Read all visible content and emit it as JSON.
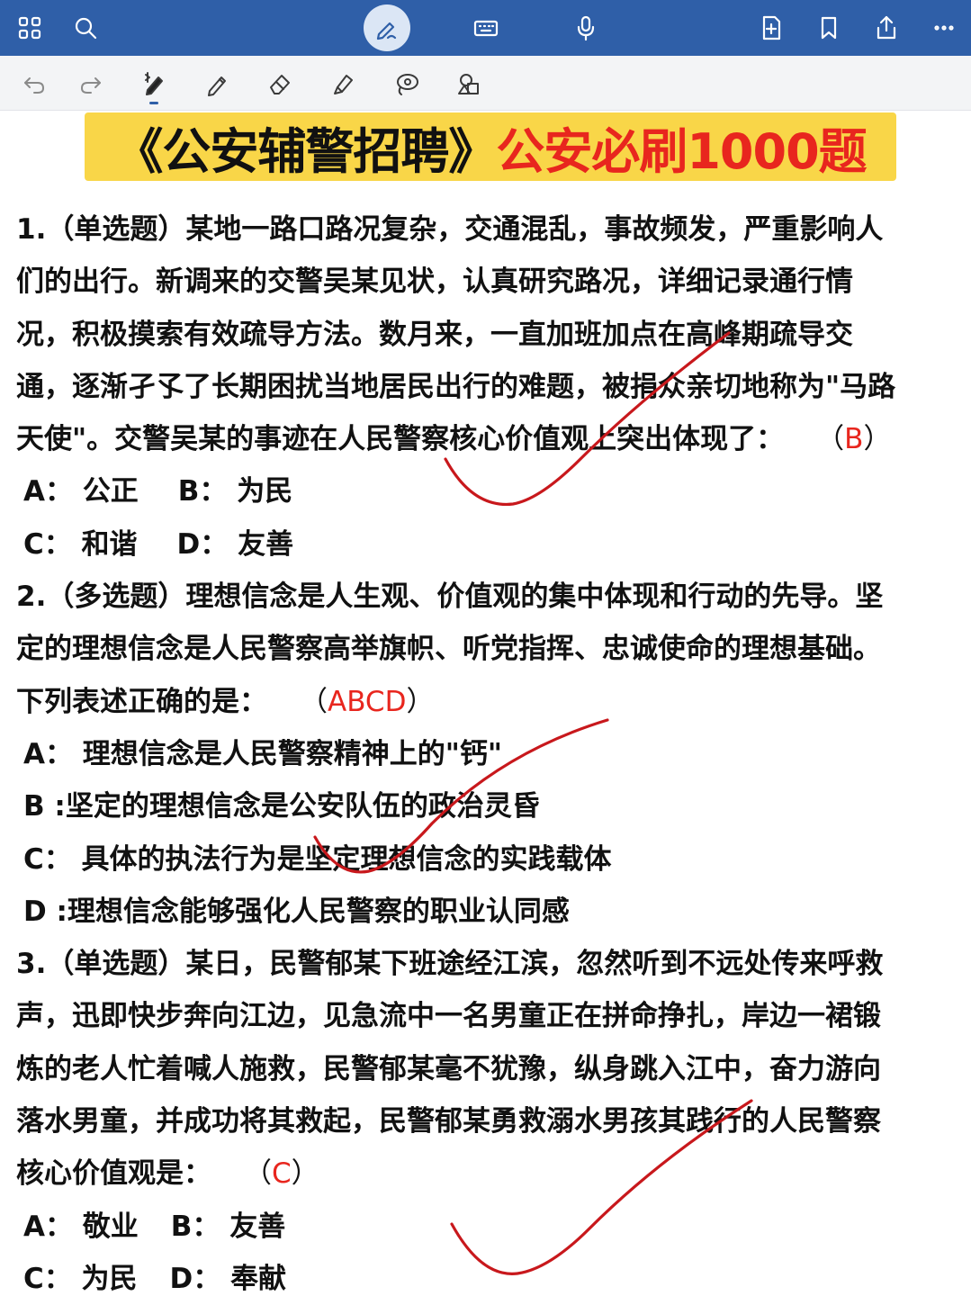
{
  "toolbar_top": {
    "icons": [
      "grid-icon",
      "search-icon",
      "pen-icon",
      "keyboard-icon",
      "microphone-icon",
      "add-page-icon",
      "bookmark-icon",
      "share-icon",
      "more-icon"
    ]
  },
  "toolbar_tools": {
    "icons": [
      "undo-icon",
      "redo-icon",
      "bluetooth-pen-icon",
      "pencil-icon",
      "eraser-icon",
      "highlighter-icon",
      "lasso-icon",
      "shapes-icon"
    ]
  },
  "banner": {
    "part1": "《公安辅警招聘》",
    "part2": "公安必刷1000题",
    "bg_color": "#f9d648",
    "accent_color": "#e8261e"
  },
  "q1": {
    "lines": [
      "1.（单选题）某地一路口路况复杂，交通混乱，事故频发，严重影响人",
      "们的出行。新调来的交警吴某见状，认真研究路况，详细记录通行情",
      "况，积极摸索有效疏导方法。数月来，一直加班加点在高峰期疏导交",
      "通，逐渐孑孓了长期困扰当地居民出行的难题，被捐众亲切地称为\"马路"
    ],
    "last_line": "天使\"。交警吴某的事迹在人民警察核心价值观上突出体现了：",
    "answer_open": "（",
    "answer": "B",
    "answer_close": "）",
    "options": [
      [
        "A： 公正",
        "B： 为民"
      ],
      [
        "C： 和谐",
        "D： 友善"
      ]
    ]
  },
  "q2": {
    "lines": [
      "2.（多选题）理想信念是人生观、价值观的集中体现和行动的先导。坚",
      "定的理想信念是人民警察高举旗帜、听党指挥、忠诚使命的理想基础。"
    ],
    "last_line": "下列表述正确的是：",
    "answer_open": "（",
    "answer": "ABCD",
    "answer_close": "）",
    "options": [
      "A： 理想信念是人民警察精神上的\"钙\"",
      "B :坚定的理想信念是公安队伍的政治灵昏",
      "C： 具体的执法行为是坚定理想信念的实践载体",
      "D :理想信念能够强化人民警察的职业认同感"
    ]
  },
  "q3": {
    "lines": [
      "3.（单选题）某日，民警郁某下班途经江滨，忽然听到不远处传来呼救",
      "声，迅即快步奔向江边，见急流中一名男童正在拼命挣扎，岸边一裙锻",
      "炼的老人忙着喊人施救，民警郁某毫不犹豫，纵身跳入江中，奋力游向",
      "落水男童，并成功将其救起，民警郁某勇救溺水男孩其践行的人民警察"
    ],
    "last_line": "核心价值观是：",
    "answer_open": "（",
    "answer": "C",
    "answer_close": "）",
    "options": [
      [
        "A： 敬业",
        "B： 友善"
      ],
      [
        "C： 为民",
        "D： 奉献"
      ]
    ]
  }
}
